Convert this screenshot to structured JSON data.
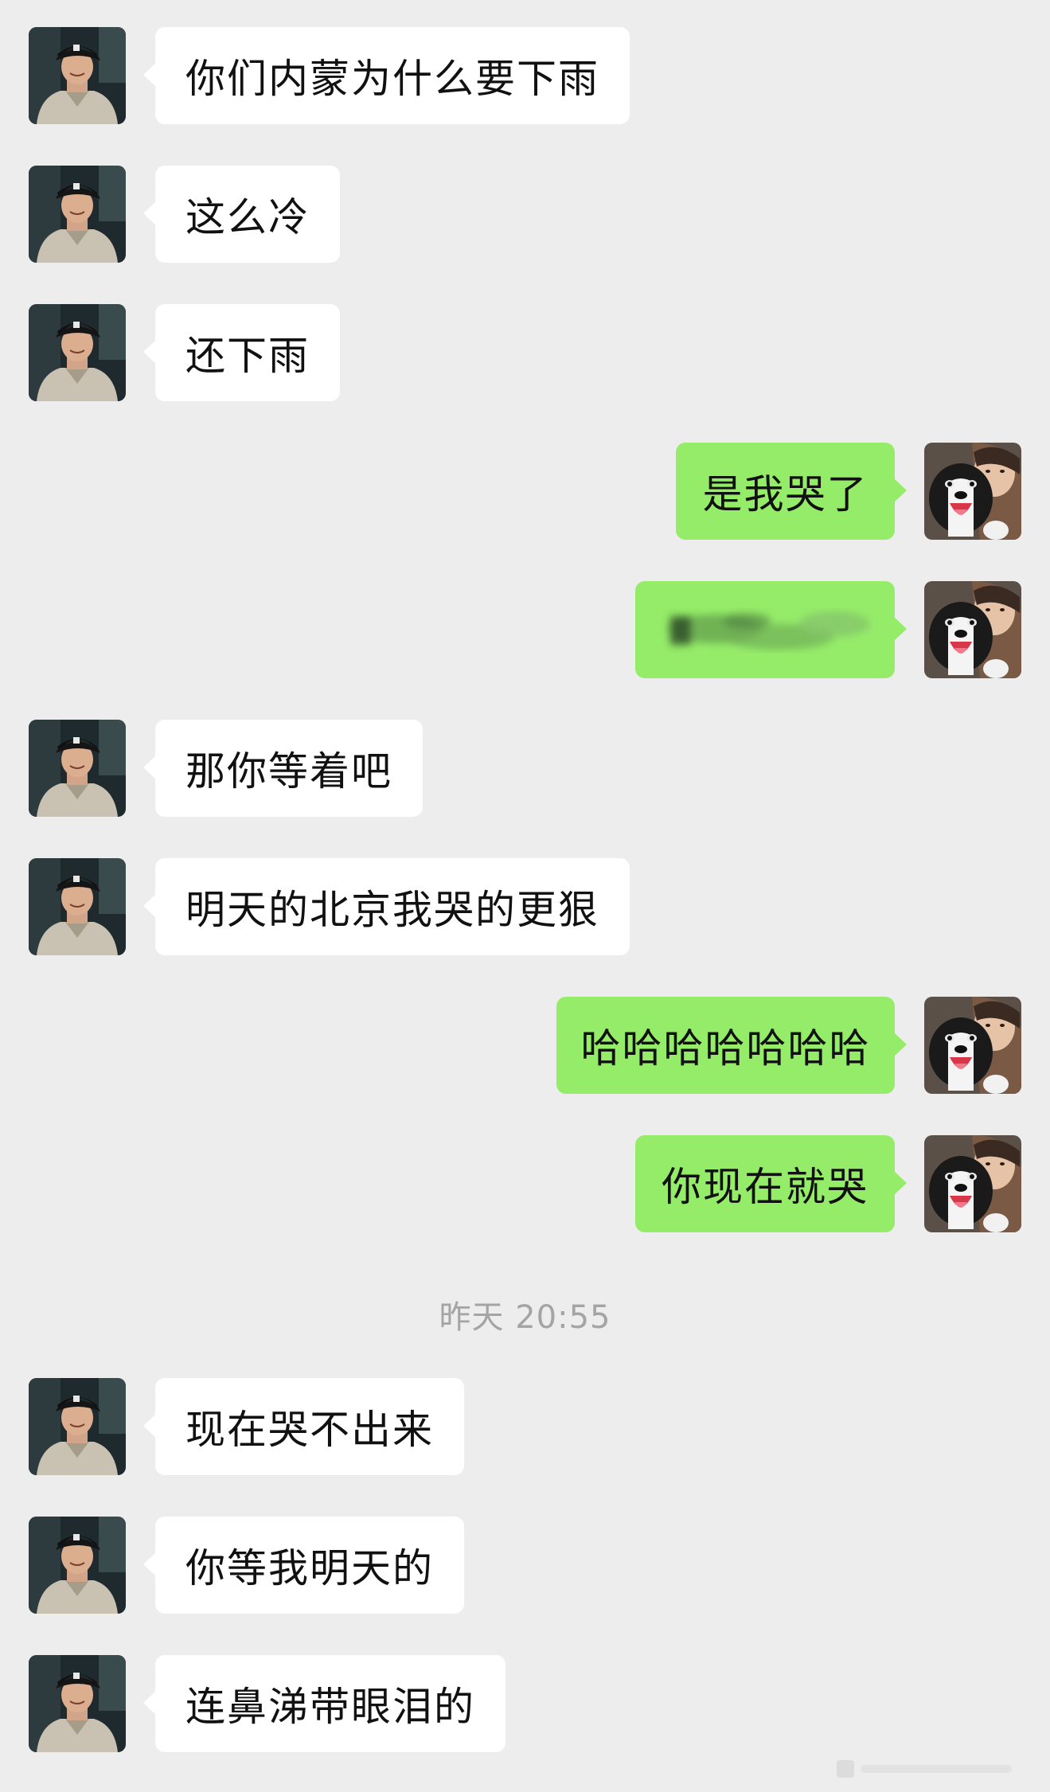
{
  "timestamp": "昨天 20:55",
  "colors": {
    "background": "#ededed",
    "incoming_bubble": "#ffffff",
    "outgoing_bubble": "#95ec69",
    "text": "#111111",
    "timestamp_text": "#a4a4a4"
  },
  "avatars": {
    "incoming": "man-in-cap-avatar",
    "outgoing": "woman-with-dog-avatar"
  },
  "messages": [
    {
      "side": "incoming",
      "text": "你们内蒙为什么要下雨"
    },
    {
      "side": "incoming",
      "text": "这么冷"
    },
    {
      "side": "incoming",
      "text": "还下雨"
    },
    {
      "side": "outgoing",
      "text": "是我哭了"
    },
    {
      "side": "outgoing",
      "text": "",
      "redacted": true
    },
    {
      "side": "incoming",
      "text": "那你等着吧"
    },
    {
      "side": "incoming",
      "text": "明天的北京我哭的更狠"
    },
    {
      "side": "outgoing",
      "text": "哈哈哈哈哈哈哈"
    },
    {
      "side": "outgoing",
      "text": "你现在就哭"
    },
    {
      "side": "incoming",
      "text": "现在哭不出来"
    },
    {
      "side": "incoming",
      "text": "你等我明天的"
    },
    {
      "side": "incoming",
      "text": "连鼻涕带眼泪的"
    }
  ]
}
